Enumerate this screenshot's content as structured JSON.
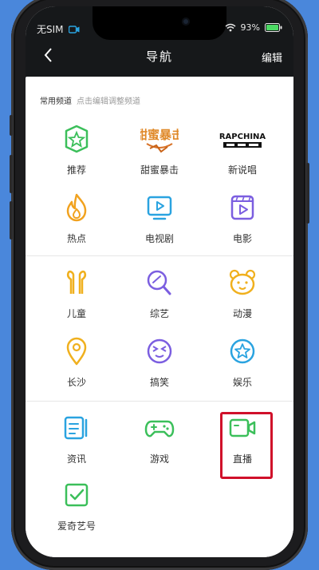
{
  "status": {
    "carrier": "无SIM",
    "battery": "93%"
  },
  "nav": {
    "title": "导航",
    "edit_label": "编辑"
  },
  "section": {
    "title": "常用频道",
    "hint": "点击编辑调整频道"
  },
  "items": [
    {
      "label": "推荐",
      "icon": "star-badge-icon",
      "color": "#3bbf5a"
    },
    {
      "label": "甜蜜暴击",
      "icon": "show-poster-icon",
      "color": "#e08a2a",
      "poster_text": "甜蜜暴击"
    },
    {
      "label": "新说唱",
      "icon": "rap-logo-icon",
      "color": "#111111",
      "poster_text": "RAPCHINA"
    },
    {
      "label": "热点",
      "icon": "flame-icon",
      "color": "#f1a21f"
    },
    {
      "label": "电视剧",
      "icon": "tv-icon",
      "color": "#2aa3e0"
    },
    {
      "label": "电影",
      "icon": "film-icon",
      "color": "#7b5ee0"
    },
    {
      "label": "儿童",
      "icon": "kids-icon",
      "color": "#f0b01e"
    },
    {
      "label": "综艺",
      "icon": "magnifier-mic-icon",
      "color": "#7b5ee0"
    },
    {
      "label": "动漫",
      "icon": "bear-face-icon",
      "color": "#f0b01e"
    },
    {
      "label": "长沙",
      "icon": "location-pin-icon",
      "color": "#f0b01e"
    },
    {
      "label": "搞笑",
      "icon": "funny-face-icon",
      "color": "#7b5ee0"
    },
    {
      "label": "娱乐",
      "icon": "star-circle-icon",
      "color": "#2aa3e0"
    },
    {
      "label": "资讯",
      "icon": "news-icon",
      "color": "#2aa3e0"
    },
    {
      "label": "游戏",
      "icon": "gamepad-icon",
      "color": "#3bbf5a"
    },
    {
      "label": "直播",
      "icon": "video-camera-icon",
      "color": "#3bbf5a"
    },
    {
      "label": "爱奇艺号",
      "icon": "checkbox-icon",
      "color": "#3bbf5a"
    }
  ]
}
